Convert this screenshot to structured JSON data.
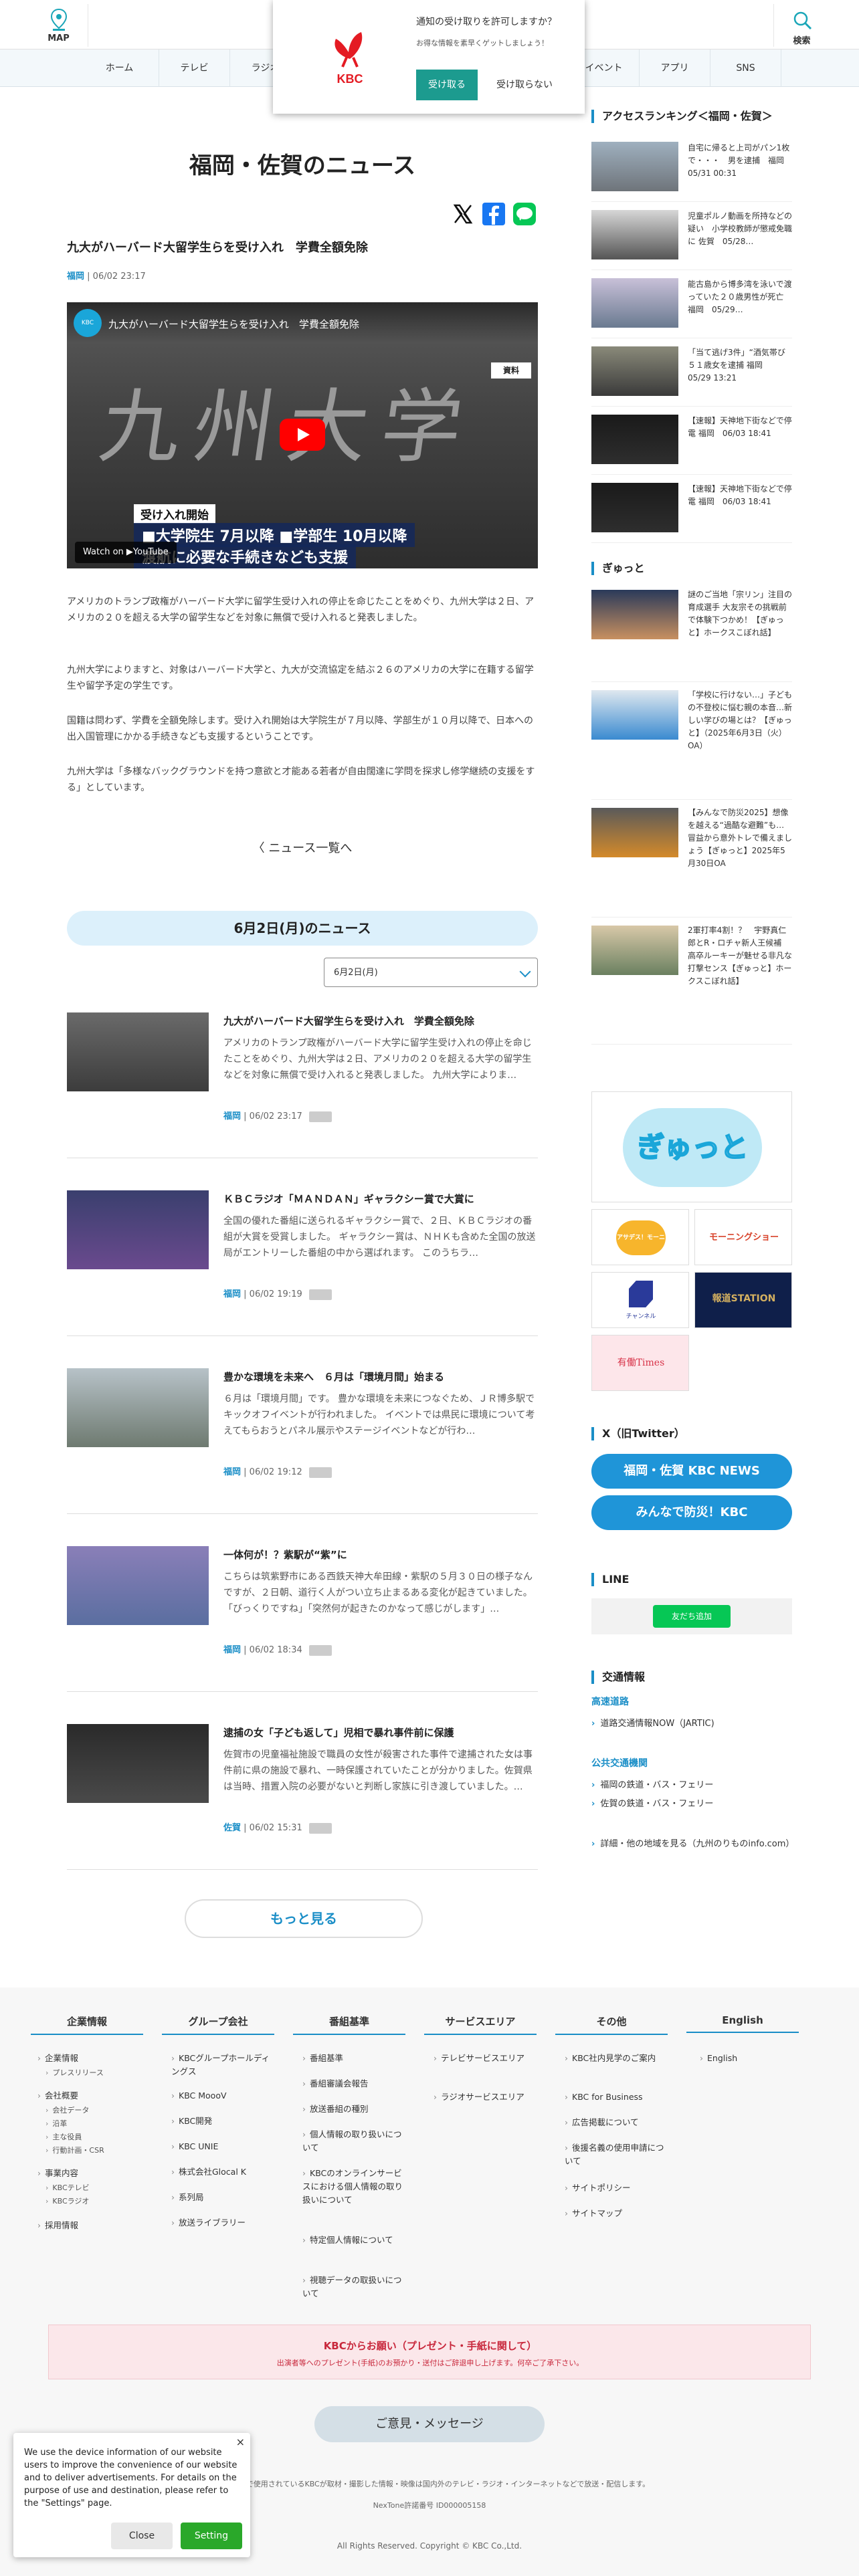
{
  "header": {
    "map_label": "MAP",
    "search_label": "検索",
    "nav": [
      "ホーム",
      "テレビ",
      "ラジオ",
      "イベント",
      "アプリ",
      "SNS"
    ]
  },
  "notification": {
    "title": "通知の受け取りを許可しますか？",
    "subtitle": "お得な情報を素早くゲットしましょう！",
    "accept": "受け取る",
    "deny": "受け取らない",
    "logo_text": "KBC"
  },
  "main": {
    "page_title": "福岡・佐賀のニュース",
    "article": {
      "title": "九大がハーバード大留学生らを受け入れ　学費全額免除",
      "area": "福岡",
      "date": "06/02 23:17",
      "video": {
        "title": "九大がハーバード大留学生らを受け入れ　学費全額免除",
        "tag": "資料",
        "caption1": "受け入れ開始",
        "caption2": "■大学院生  7月以降  ■学部生  10月以降",
        "caption3": "渡航に必要な手続きなども支援",
        "watch_on": "Watch on ▶YouTube"
      },
      "paragraphs": [
        "アメリカのトランプ政権がハーバード大学に留学生受け入れの停止を命じたことをめぐり、九州大学は２日、アメリカの２０を超える大学の留学生などを対象に無償で受け入れると発表しました。",
        "九州大学によりますと、対象はハーバード大学と、九大が交流協定を結ぶ２６のアメリカの大学に在籍する留学生や留学予定の学生です。",
        "国籍は問わず、学費を全額免除します。受け入れ開始は大学院生が７月以降、学部生が１０月以降で、日本への出入国管理にかかる手続きなども支援するということです。",
        "九州大学は「多様なバックグラウンドを持つ意欲と才能ある若者が自由闊達に学問を探求し修学継続の支援をする」としています。"
      ],
      "back_link": "ニュース一覧へ"
    },
    "day_heading": "6月2日(月)のニュース",
    "date_select": "6月2日(月)",
    "news": [
      {
        "title": "九大がハーバード大留学生らを受け入れ　学費全額免除",
        "excerpt": "アメリカのトランプ政権がハーバード大学に留学生受け入れの停止を命じたことをめぐり、九州大学は２日、アメリカの２０を超える大学の留学生などを対象に無償で受け入れると発表しました。 九州大学によりま…",
        "area": "福岡",
        "date": "06/02 23:17"
      },
      {
        "title": "ＫＢＣラジオ「ＭＡＮＤＡＮ」ギャラクシー賞で大賞に",
        "excerpt": "全国の優れた番組に送られるギャラクシー賞で、２日、ＫＢＣラジオの番組が大賞を受賞しました。 ギャラクシー賞は、ＮＨＫも含めた全国の放送局がエントリーした番組の中から選ばれます。 このうちラ…",
        "area": "福岡",
        "date": "06/02 19:19"
      },
      {
        "title": "豊かな環境を未来へ　６月は「環境月間」始まる",
        "excerpt": "６月は「環境月間」です。 豊かな環境を未来につなぐため、ＪＲ博多駅でキックオフイベントが行われました。 イベントでは県民に環境について考えてもらおうとパネル展示やステージイベントなどが行わ…",
        "area": "福岡",
        "date": "06/02 19:12"
      },
      {
        "title": "一体何が！？紫駅が“紫”に",
        "excerpt": "こちらは筑紫野市にある西鉄天神大牟田線・紫駅の５月３０日の様子なんですが、２日朝、道行く人がつい立ち止まるある変化が起きていました。「びっくりですね」「突然何が起きたのかなって感じがします」…",
        "area": "福岡",
        "date": "06/02 18:34"
      },
      {
        "title": "逮捕の女「子ども返して」児相で暴れ事件前に保護",
        "excerpt": "佐賀市の児童福祉施設で職員の女性が殺害された事件で逮捕された女は事件前に県の施設で暴れ、一時保護されていたことが分かりました。佐賀県は当時、措置入院の必要がないと判断し家族に引き渡していました。…",
        "area": "佐賀",
        "date": "06/02 15:31"
      }
    ],
    "more_button": "もっと見る"
  },
  "sidebar": {
    "ranking_heading": "アクセスランキング＜福岡・佐賀＞",
    "ranking": [
      "自宅に帰ると上司がパン1枚で・・・　男を逮捕　福岡　05/31 00:31",
      "児童ポルノ動画を所持などの疑い　小学校教師が懲戒免職に 佐賀　05/28…",
      "能古島から博多湾を泳いで渡っていた２０歳男性が死亡 福岡　05/29…",
      "「当て逃げ3件」“酒気帯び５１歳女を逮捕 福岡　05/29 13:21",
      "【速報】天神地下街などで停電 福岡　06/03 18:41",
      "【速報】天神地下街などで停電 福岡　06/03 18:41"
    ],
    "gyutto_heading": "ぎゅっと",
    "gyutto": [
      "謎のご当地「宗リン」注目の育成選手 大友宗その挑戦前で体験下つかめ！【ぎゅっと】ホークスこぼれ話】",
      "「学校に行けない…」子どもの不登校に悩む親の本音…新しい学びの場とは？【ぎゅっと】（2025年6月3日（火）OA）",
      "【みんなで防災2025】想像を越える“過酷な避難”も…冒益から意外トレで備えましょう【ぎゅっと】2025年5月30日OA",
      "2軍打率4割！？　宇野真仁郎とR・ロチャ新人王候補 高卒ルーキーが魅せる非凡な打撃センス【ぎゅっと】ホークスこぼれ話】"
    ],
    "banners": {
      "gyutto": "ぎゅっと",
      "morning1": "アサデス！モーニング",
      "morning2": "モーニングショー",
      "channel": "チャンネル",
      "station": "報道STATION",
      "times": "有働Times"
    },
    "x_heading": "X（旧Twitter）",
    "x_buttons": [
      "福岡・佐賀 KBC NEWS",
      "みんなで防災！KBC"
    ],
    "line_heading": "LINE",
    "line_button": "友だち追加",
    "traffic_heading": "交通情報",
    "traffic_road": "高速道路",
    "traffic_road_links": [
      "道路交通情報NOW（JARTIC)"
    ],
    "traffic_public": "公共交通機関",
    "traffic_public_links": [
      "福岡の鉄道・バス・フェリー",
      "佐賀の鉄道・バス・フェリー"
    ],
    "traffic_other": "詳細・他の地域を見る（九州のりものinfo.com）"
  },
  "footer": {
    "columns": [
      {
        "title": "企業情報",
        "links": [
          "企業情報",
          "プレスリリース",
          "会社概要",
          "会社データ",
          "沿革",
          "主な役員",
          "行動計画・CSR",
          "事業内容",
          "KBCテレビ",
          "KBCラジオ",
          "採用情報"
        ]
      },
      {
        "title": "グループ会社",
        "links": [
          "KBCグループホールディングス",
          "KBC MoooV",
          "KBC開発",
          "KBC UNIE",
          "株式会社Glocal K",
          "系列局",
          "放送ライブラリー"
        ]
      },
      {
        "title": "番組基準",
        "links": [
          "番組基準",
          "番組審議会報告",
          "放送番組の種別",
          "個人情報の取り扱いについて",
          "KBCのオンラインサービスにおける個人情報の取り扱いについて",
          "特定個人情報について",
          "視聴データの取扱いについて"
        ]
      },
      {
        "title": "サービスエリア",
        "links": [
          "テレビサービスエリア",
          "ラジオサービスエリア"
        ]
      },
      {
        "title": "その他",
        "links": [
          "KBC社内見学のご案内",
          "KBC for Business",
          "広告掲載について",
          "後援名義の使用申請について",
          "サイトポリシー",
          "サイトマップ"
        ]
      },
      {
        "title": "English",
        "links": [
          "English"
        ]
      }
    ],
    "present_title": "KBCからお願い（プレゼント・手紙に関して）",
    "present_sub": "出演者等へのプレゼント(手紙)のお預かり・送付はご辞退申し上げます。何卒ご了承下さい。",
    "opinion_button": "ご意見・メッセージ",
    "note": "このサイトで使用されているKBCが取材・撮影した情報・映像は国内外のテレビ・ラジオ・インターネットなどで放送・配信します。",
    "id": "NexTone許諾番号 ID000005158",
    "copyright": "All Rights Reserved. Copyright © KBC Co.,Ltd."
  },
  "cookie": {
    "text": "We use the device information of our website users to improve the convenience of our website and to deliver advertisements. For details on the purpose of use and destination, please refer to the \"Settings\" page.",
    "close": "Close",
    "setting": "Setting"
  },
  "colors": {
    "accent": "#1a8ec7",
    "teal": "#1c9b8f",
    "x_blue": "#1f95d8",
    "line_green": "#06c755"
  }
}
